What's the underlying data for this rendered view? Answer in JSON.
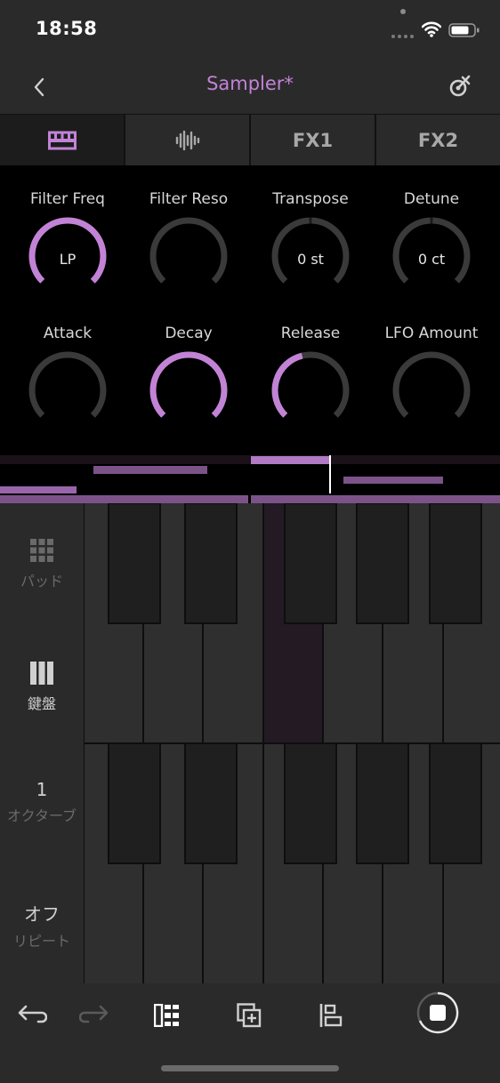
{
  "status": {
    "time": "18:58"
  },
  "header": {
    "title": "Sampler*"
  },
  "tabs": [
    {
      "id": "keyboard",
      "label": "",
      "icon": "piano-keys-icon",
      "active": true
    },
    {
      "id": "waveform",
      "label": "",
      "icon": "waveform-icon",
      "active": false
    },
    {
      "id": "fx1",
      "label": "FX1",
      "icon": "",
      "active": false
    },
    {
      "id": "fx2",
      "label": "FX2",
      "icon": "",
      "active": false
    }
  ],
  "knobs": [
    {
      "label": "Filter Freq",
      "value": "LP",
      "level": 1.0,
      "style": "full"
    },
    {
      "label": "Filter Reso",
      "value": "",
      "level": 0.0,
      "style": "from-min"
    },
    {
      "label": "Transpose",
      "value": "0 st",
      "level": 0.5,
      "style": "center"
    },
    {
      "label": "Detune",
      "value": "0 ct",
      "level": 0.5,
      "style": "center"
    },
    {
      "label": "Attack",
      "value": "",
      "level": 0.0,
      "style": "from-min"
    },
    {
      "label": "Decay",
      "value": "",
      "level": 1.0,
      "style": "from-min"
    },
    {
      "label": "Release",
      "value": "",
      "level": 0.45,
      "style": "from-min"
    },
    {
      "label": "LFO Amount",
      "value": "",
      "level": 0.0,
      "style": "from-min"
    }
  ],
  "side": {
    "pad_label": "パッド",
    "keys_label": "鍵盤",
    "octave_value": "1",
    "octave_label": "オクターブ",
    "repeat_value": "オフ",
    "repeat_label": "リピート"
  },
  "keyboard": {
    "highlighted_key": "C"
  },
  "colors": {
    "accent": "#c283d6",
    "panel": "#2a2a2a",
    "key": "#2f2f2f",
    "black_key": "#1f1f1f"
  }
}
